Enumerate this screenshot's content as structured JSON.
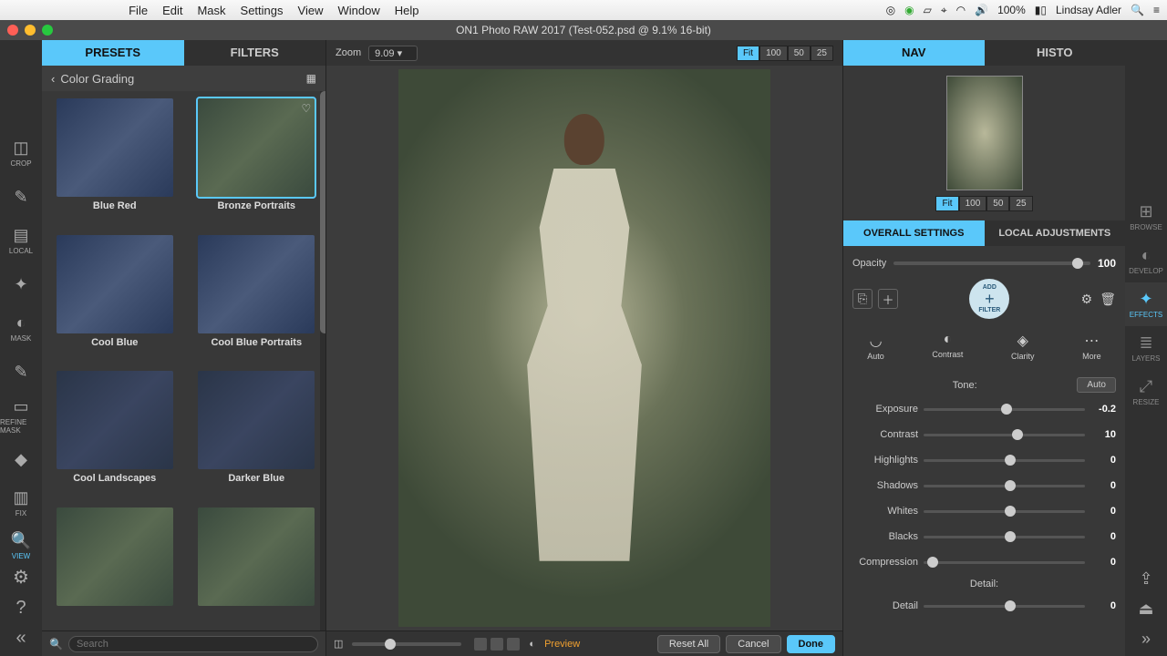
{
  "menubar": {
    "app": "ON1 Photo RAW",
    "items": [
      "File",
      "Edit",
      "Mask",
      "Settings",
      "View",
      "Window",
      "Help"
    ],
    "battery": "100%",
    "user": "Lindsay Adler"
  },
  "window": {
    "title": "ON1 Photo RAW 2017 (Test-052.psd @ 9.1% 16-bit)"
  },
  "lefttools": [
    {
      "glyph": "◫",
      "label": "CROP"
    },
    {
      "glyph": "✎",
      "label": ""
    },
    {
      "glyph": "▤",
      "label": "LOCAL"
    },
    {
      "glyph": "✦",
      "label": ""
    },
    {
      "glyph": "◐",
      "label": "MASK"
    },
    {
      "glyph": "✎",
      "label": ""
    },
    {
      "glyph": "▭",
      "label": "REFINE MASK"
    },
    {
      "glyph": "◆",
      "label": ""
    },
    {
      "glyph": "▥",
      "label": "FIX"
    }
  ],
  "viewtool": {
    "glyph": "🔍",
    "label": "VIEW"
  },
  "righttools": [
    {
      "glyph": "⊞",
      "label": "BROWSE"
    },
    {
      "glyph": "◐",
      "label": "DEVELOP"
    },
    {
      "glyph": "✦",
      "label": "EFFECTS",
      "active": true
    },
    {
      "glyph": "≣",
      "label": "LAYERS"
    },
    {
      "glyph": "⤢",
      "label": "RESIZE"
    }
  ],
  "leftTabs": {
    "presets": "PRESETS",
    "filters": "FILTERS"
  },
  "crumb": "Color Grading",
  "presets": [
    {
      "name": "Blue Red",
      "cls": "blue"
    },
    {
      "name": "Bronze Portraits",
      "cls": "",
      "sel": true,
      "fav": true
    },
    {
      "name": "Cool Blue",
      "cls": "blue"
    },
    {
      "name": "Cool Blue Portraits",
      "cls": "blue"
    },
    {
      "name": "Cool Landscapes",
      "cls": "dark"
    },
    {
      "name": "Darker Blue",
      "cls": "dark"
    },
    {
      "name": "",
      "cls": ""
    },
    {
      "name": "",
      "cls": ""
    }
  ],
  "search": {
    "placeholder": "Search"
  },
  "zoom": {
    "label": "Zoom",
    "value": "9.09"
  },
  "zoomBtns": [
    "Fit",
    "100",
    "50",
    "25"
  ],
  "rightTabs": {
    "nav": "NAV",
    "histo": "HISTO"
  },
  "settingsTabs": {
    "overall": "OVERALL SETTINGS",
    "local": "LOCAL ADJUSTMENTS"
  },
  "opacity": {
    "label": "Opacity",
    "value": "100"
  },
  "addFilter": {
    "top": "ADD",
    "bottom": "FILTER"
  },
  "quick": [
    {
      "g": "◡",
      "label": "Auto"
    },
    {
      "g": "◐",
      "label": "Contrast"
    },
    {
      "g": "◈",
      "label": "Clarity"
    },
    {
      "g": "⋯",
      "label": "More"
    }
  ],
  "tone": {
    "label": "Tone:",
    "auto": "Auto"
  },
  "sliders": [
    {
      "label": "Exposure",
      "value": "-0.2",
      "pos": 48
    },
    {
      "label": "Contrast",
      "value": "10",
      "pos": 55
    },
    {
      "label": "Highlights",
      "value": "0",
      "pos": 50
    },
    {
      "label": "Shadows",
      "value": "0",
      "pos": 50
    },
    {
      "label": "Whites",
      "value": "0",
      "pos": 50
    },
    {
      "label": "Blacks",
      "value": "0",
      "pos": 50
    },
    {
      "label": "Compression",
      "value": "0",
      "pos": 2
    }
  ],
  "detail": {
    "header": "Detail:",
    "label": "Detail",
    "value": "0",
    "pos": 50
  },
  "bottombar": {
    "preview": "Preview",
    "resetAll": "Reset All",
    "cancel": "Cancel",
    "done": "Done"
  }
}
